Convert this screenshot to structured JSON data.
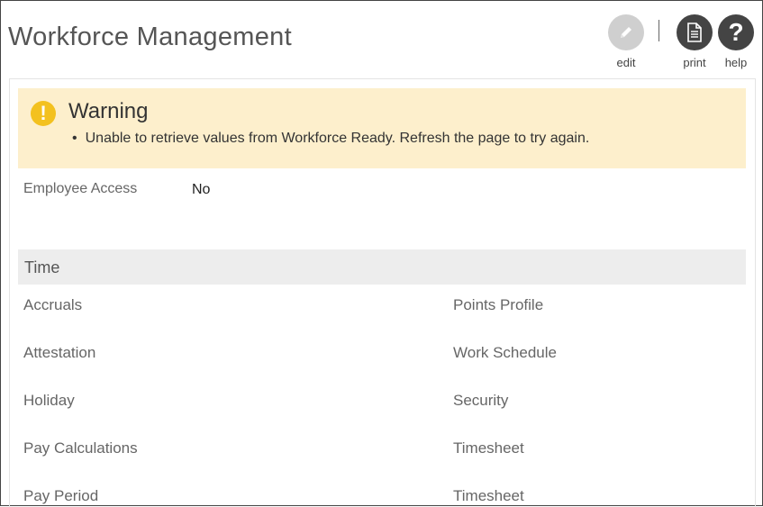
{
  "header": {
    "title": "Workforce Management",
    "tools": {
      "edit": {
        "label": "edit",
        "icon": "pencil-icon"
      },
      "print": {
        "label": "print",
        "icon": "document-icon"
      },
      "help": {
        "label": "help",
        "icon": "question-icon",
        "glyph": "?"
      }
    }
  },
  "warning": {
    "icon": "exclamation-icon",
    "icon_glyph": "!",
    "title": "Warning",
    "message": "Unable to retrieve values from Workforce Ready. Refresh the page to try again.",
    "bullet": "•",
    "background_color": "#fdefcc",
    "icon_color": "#f3c11f"
  },
  "fields": {
    "employee_access": {
      "label": "Employee Access",
      "value": "No"
    }
  },
  "section": {
    "title": "Time",
    "left_items": [
      "Accruals",
      "Attestation",
      "Holiday",
      "Pay Calculations",
      "Pay Period"
    ],
    "right_items": [
      "Points Profile",
      "Work Schedule",
      "Security",
      "Timesheet",
      "Timesheet"
    ]
  }
}
